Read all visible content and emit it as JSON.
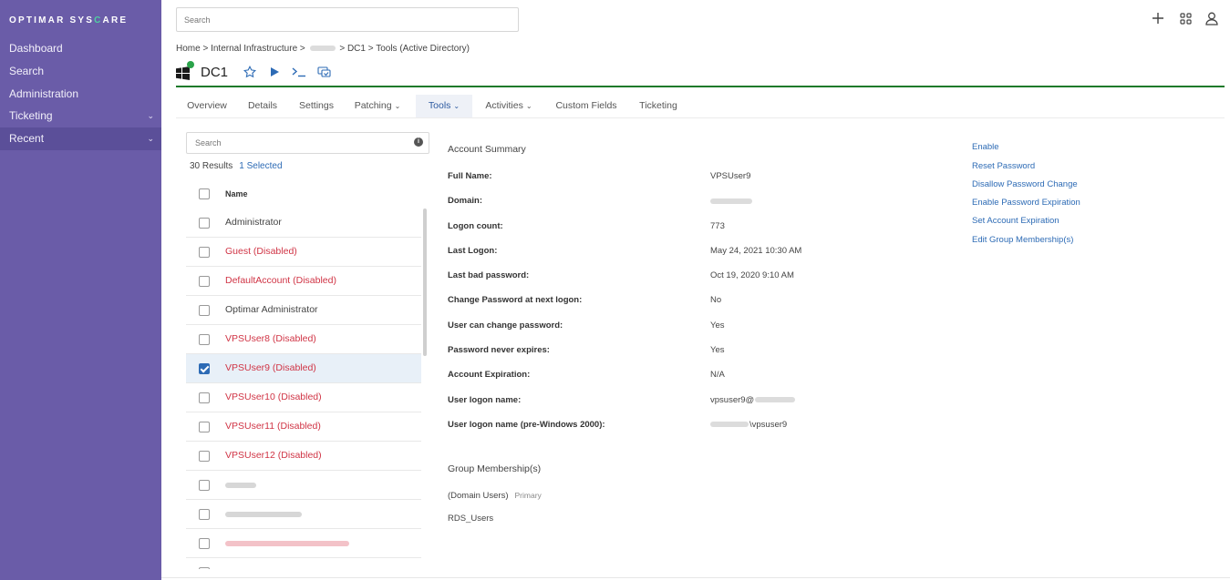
{
  "colors": {
    "sidebar": "#6a5ca8",
    "accent": "#2d6bb5",
    "disabled_text": "#d03445",
    "status_online": "#2aa34a",
    "divider_green": "#1d7a2a"
  },
  "sidebar": {
    "logo_prefix": "OPTIMAR SYS",
    "logo_highlight": "C",
    "logo_suffix": "ARE",
    "items": [
      {
        "label": "Dashboard"
      },
      {
        "label": "Search"
      },
      {
        "label": "Administration"
      },
      {
        "label": "Ticketing",
        "expandable": true
      },
      {
        "label": "Recent",
        "expandable": true,
        "active": true
      }
    ]
  },
  "topbar": {
    "search_placeholder": "Search",
    "icons": [
      "plus-icon",
      "apps-grid-icon",
      "user-icon"
    ]
  },
  "breadcrumb": {
    "items": [
      "Home",
      "Internal Infrastructure",
      "DC1",
      "Tools (Active Directory)"
    ],
    "separator": ">"
  },
  "device": {
    "name": "DC1",
    "os_icon": "windows-icon",
    "status": "online",
    "actions": [
      "favorite-star-icon",
      "play-icon",
      "terminal-icon",
      "remote-desktop-icon"
    ]
  },
  "tabs": [
    {
      "label": "Overview"
    },
    {
      "label": "Details"
    },
    {
      "label": "Settings"
    },
    {
      "label": "Patching",
      "dropdown": true
    },
    {
      "label": "Tools",
      "dropdown": true,
      "active": true
    },
    {
      "label": "Activities",
      "dropdown": true
    },
    {
      "label": "Custom Fields"
    },
    {
      "label": "Ticketing"
    }
  ],
  "list": {
    "search_placeholder": "Search",
    "results_count": "30 Results",
    "selected_count": "1 Selected",
    "header_name": "Name",
    "rows": [
      {
        "name": "Administrator",
        "disabled": false,
        "checked": false
      },
      {
        "name": "Guest (Disabled)",
        "disabled": true,
        "checked": false
      },
      {
        "name": "DefaultAccount (Disabled)",
        "disabled": true,
        "checked": false
      },
      {
        "name": "Optimar Administrator",
        "disabled": false,
        "checked": false
      },
      {
        "name": "VPSUser8 (Disabled)",
        "disabled": true,
        "checked": false
      },
      {
        "name": "VPSUser9 (Disabled)",
        "disabled": true,
        "checked": true
      },
      {
        "name": "VPSUser10 (Disabled)",
        "disabled": true,
        "checked": false
      },
      {
        "name": "VPSUser11 (Disabled)",
        "disabled": true,
        "checked": false
      },
      {
        "name": "VPSUser12 (Disabled)",
        "disabled": true,
        "checked": false
      }
    ]
  },
  "account_summary": {
    "title": "Account Summary",
    "fields": [
      {
        "label": "Full Name:",
        "value": "VPSUser9"
      },
      {
        "label": "Domain:",
        "value": ""
      },
      {
        "label": "Logon count:",
        "value": "773"
      },
      {
        "label": "Last Logon:",
        "value": "May 24, 2021 10:30 AM"
      },
      {
        "label": "Last bad password:",
        "value": "Oct 19, 2020 9:10 AM"
      },
      {
        "label": "Change Password at next logon:",
        "value": "No"
      },
      {
        "label": "User can change password:",
        "value": "Yes"
      },
      {
        "label": "Password never expires:",
        "value": "Yes"
      },
      {
        "label": "Account Expiration:",
        "value": "N/A"
      },
      {
        "label": "User logon name:",
        "value": "vpsuser9@"
      },
      {
        "label": "User logon name (pre-Windows 2000):",
        "value": "\\vpsuser9"
      }
    ]
  },
  "group_membership": {
    "title": "Group Membership(s)",
    "groups": [
      {
        "name": "(Domain Users)",
        "tag": "Primary"
      },
      {
        "name": "RDS_Users",
        "tag": ""
      }
    ]
  },
  "actions": [
    "Enable",
    "Reset Password",
    "Disallow Password Change",
    "Enable Password Expiration",
    "Set Account Expiration",
    "Edit Group Membership(s)"
  ]
}
